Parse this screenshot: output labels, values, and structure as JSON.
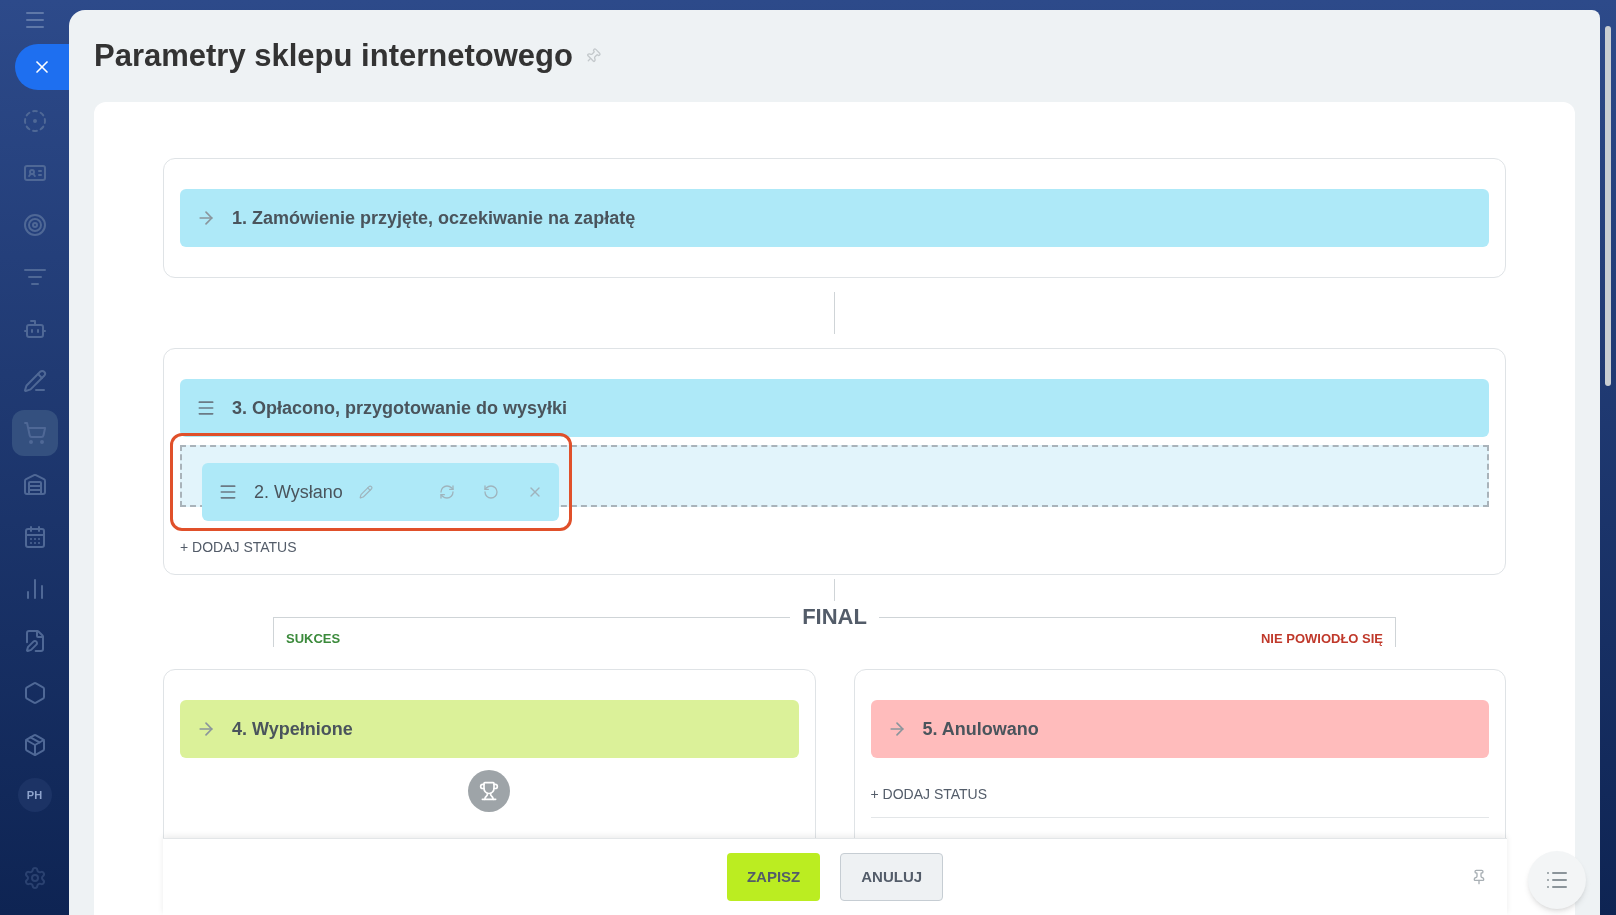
{
  "sidebar": {
    "items": [
      {
        "selected": false
      },
      {
        "selected": false
      },
      {
        "selected": false
      },
      {
        "selected": false
      },
      {
        "selected": false
      },
      {
        "selected": false
      },
      {
        "selected": true
      },
      {
        "selected": false
      },
      {
        "selected": false
      },
      {
        "selected": false
      },
      {
        "selected": false
      },
      {
        "selected": false
      },
      {
        "selected": false
      }
    ],
    "avatar": {
      "initials": "PH"
    }
  },
  "title": "Parametry sklepu internetowego",
  "stage_groups": [
    {
      "statuses": [
        {
          "label": "1. Zamówienie przyjęte, oczekiwanie na zapłatę",
          "kind": "fixed",
          "color": "#aee9f8"
        }
      ]
    },
    {
      "statuses": [
        {
          "label": "3. Opłacono, przygotowanie do wysyłki",
          "kind": "draggable",
          "color": "#aee9f8"
        }
      ],
      "dragging": {
        "label": "2. Wysłano",
        "color": "#aee9f8"
      },
      "add_label": "+ DODAJ STATUS"
    }
  ],
  "final": {
    "label": "FINAL",
    "success": {
      "label": "SUKCES",
      "statuses": [
        {
          "label": "4. Wypełnione",
          "kind": "fixed",
          "color": "#dbf199"
        }
      ]
    },
    "failure": {
      "label": "NIE POWIODŁO SIĘ",
      "statuses": [
        {
          "label": "5. Anulowano",
          "kind": "fixed",
          "color": "#ffbcbc"
        }
      ],
      "add_label": "+ DODAJ STATUS"
    }
  },
  "footer": {
    "buttons": [
      {
        "label": "ZAPISZ",
        "kind": "primary"
      },
      {
        "label": "ANULUJ",
        "kind": "secondary"
      }
    ]
  }
}
